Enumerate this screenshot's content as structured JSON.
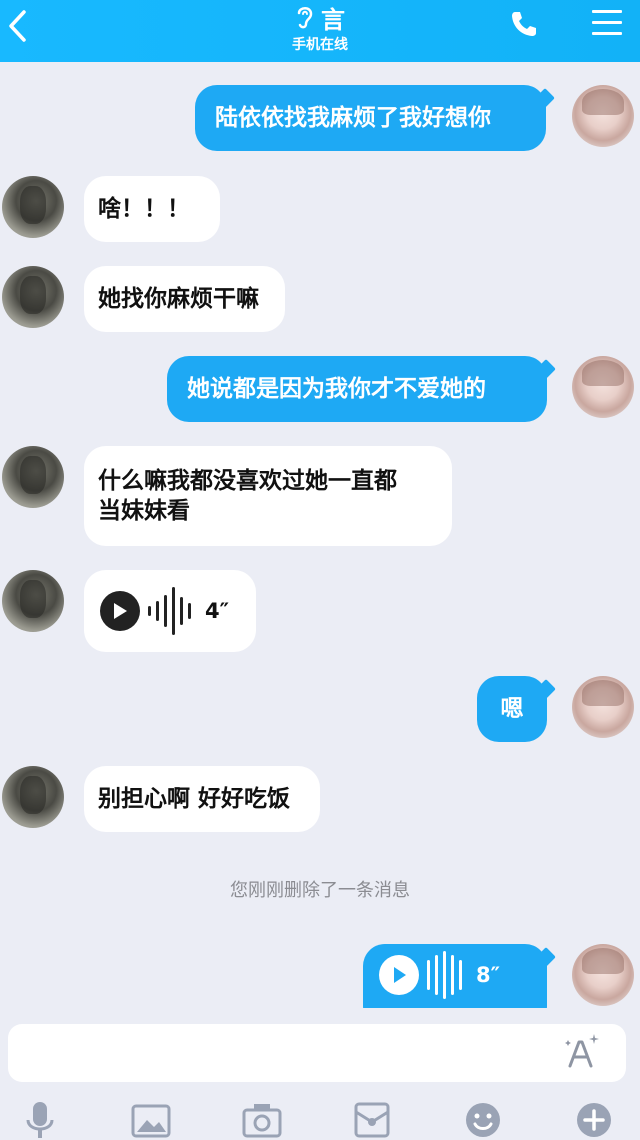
{
  "header": {
    "back_icon": "chevron-left-icon",
    "ear_icon": "ear-icon",
    "contact_name": "言",
    "status": "手机在线",
    "phone_icon": "phone-icon",
    "menu_icon": "menu-icon"
  },
  "messages": [
    {
      "sender": "me",
      "type": "text",
      "text": "陆依依找我麻烦了我好想你"
    },
    {
      "sender": "other",
      "type": "text",
      "text": "啥！！！"
    },
    {
      "sender": "other",
      "type": "text",
      "text": "她找你麻烦干嘛"
    },
    {
      "sender": "me",
      "type": "text",
      "text": "她说都是因为我你才不爱她的"
    },
    {
      "sender": "other",
      "type": "text",
      "line1": "什么嘛我都没喜欢过她一直都",
      "line2": "当妹妹看"
    },
    {
      "sender": "other",
      "type": "voice",
      "duration": "4″"
    },
    {
      "sender": "me",
      "type": "text",
      "text": "嗯"
    },
    {
      "sender": "other",
      "type": "text",
      "text": "别担心啊 好好吃饭"
    },
    {
      "sender": "me",
      "type": "voice",
      "duration": "8″"
    }
  ],
  "system_note": "您刚刚删除了一条消息",
  "input": {
    "value": "",
    "font_icon": "font-style-icon"
  },
  "toolbar": [
    "microphone-icon",
    "image-icon",
    "camera-icon",
    "red-packet-icon",
    "emoji-icon",
    "plus-icon"
  ],
  "colors": {
    "header": "#18b9ff",
    "my_bubble": "#1ea9f4",
    "other_bubble": "#ffffff",
    "background": "#ebedf5",
    "toolbar_icon": "#9aa3b5"
  }
}
